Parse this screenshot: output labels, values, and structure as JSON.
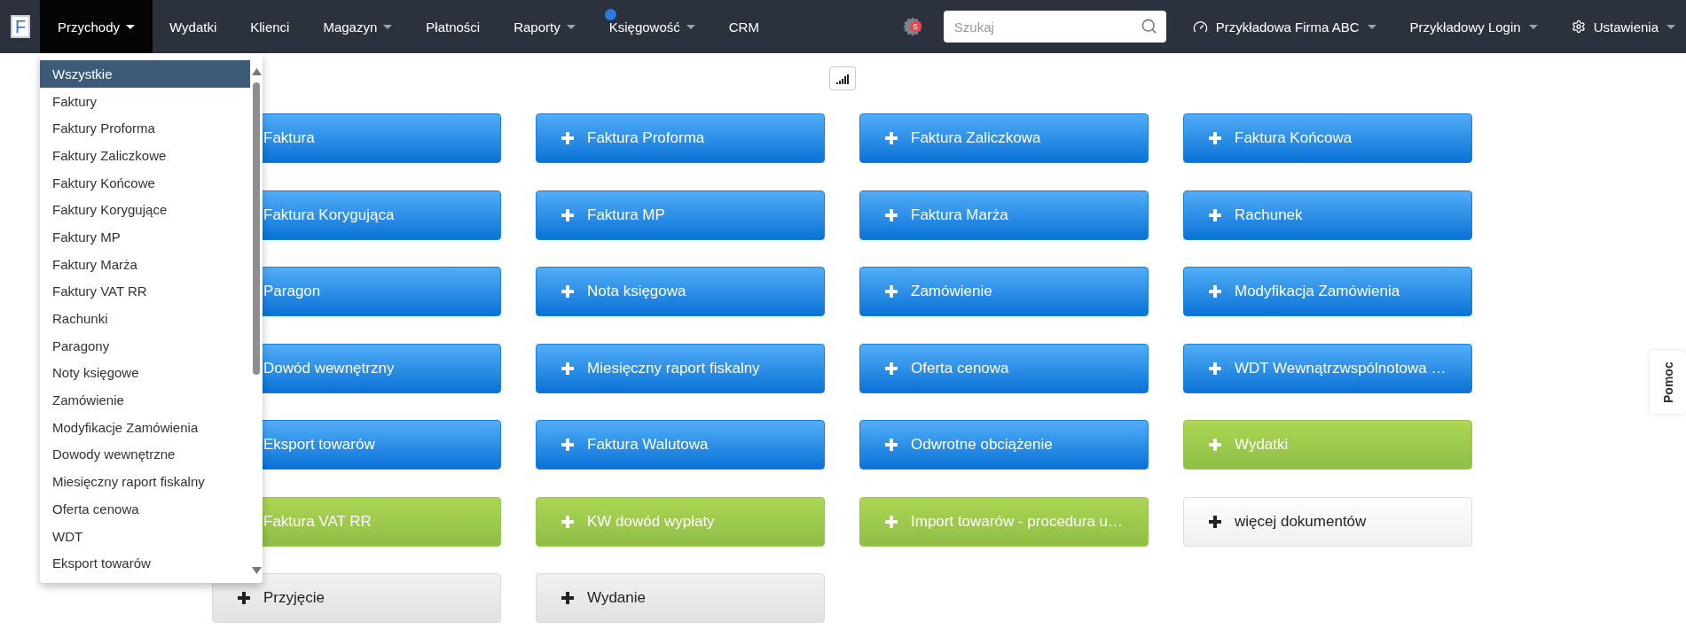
{
  "navbar": {
    "logo": "F",
    "items": [
      {
        "label": "Przychody",
        "selected": true,
        "dropdown": true,
        "info": false
      },
      {
        "label": "Wydatki",
        "selected": false,
        "dropdown": false,
        "info": false
      },
      {
        "label": "Klienci",
        "selected": false,
        "dropdown": false,
        "info": false
      },
      {
        "label": "Magazyn",
        "selected": false,
        "dropdown": true,
        "info": false
      },
      {
        "label": "Płatności",
        "selected": false,
        "dropdown": false,
        "info": false
      },
      {
        "label": "Raporty",
        "selected": false,
        "dropdown": true,
        "info": false
      },
      {
        "label": "Księgowość",
        "selected": false,
        "dropdown": true,
        "info": true
      },
      {
        "label": "CRM",
        "selected": false,
        "dropdown": false,
        "info": false
      }
    ],
    "notification_count": "5",
    "search": {
      "placeholder": "Szukaj"
    },
    "right_menus": [
      {
        "label": "Przykładowa Firma ABC",
        "kind": "dashboard"
      },
      {
        "label": "Przykładowy Login",
        "kind": "plain"
      },
      {
        "label": "Ustawienia",
        "kind": "settings"
      }
    ]
  },
  "dropdown_menu": {
    "items": [
      {
        "label": "Wszystkie",
        "selected": true
      },
      {
        "label": "Faktury",
        "selected": false
      },
      {
        "label": "Faktury Proforma",
        "selected": false
      },
      {
        "label": "Faktury Zaliczkowe",
        "selected": false
      },
      {
        "label": "Faktury Końcowe",
        "selected": false
      },
      {
        "label": "Faktury Korygujące",
        "selected": false
      },
      {
        "label": "Faktury MP",
        "selected": false
      },
      {
        "label": "Faktury Marża",
        "selected": false
      },
      {
        "label": "Faktury VAT RR",
        "selected": false
      },
      {
        "label": "Rachunki",
        "selected": false
      },
      {
        "label": "Paragony",
        "selected": false
      },
      {
        "label": "Noty księgowe",
        "selected": false
      },
      {
        "label": "Zamówienie",
        "selected": false
      },
      {
        "label": "Modyfikacje Zamówienia",
        "selected": false
      },
      {
        "label": "Dowody wewnętrzne",
        "selected": false
      },
      {
        "label": "Miesięczny raport fiskalny",
        "selected": false
      },
      {
        "label": "Oferta cenowa",
        "selected": false
      },
      {
        "label": "WDT",
        "selected": false
      },
      {
        "label": "Eksport towarów",
        "selected": false
      }
    ]
  },
  "document_buttons": [
    {
      "label": "Faktura",
      "kind": "primary",
      "plus": false
    },
    {
      "label": "Faktura Proforma",
      "kind": "primary",
      "plus": true
    },
    {
      "label": "Faktura Zaliczkowa",
      "kind": "primary",
      "plus": true
    },
    {
      "label": "Faktura Końcowa",
      "kind": "primary",
      "plus": true
    },
    {
      "label": "Faktura Korygująca",
      "kind": "primary",
      "plus": false
    },
    {
      "label": "Faktura MP",
      "kind": "primary",
      "plus": true
    },
    {
      "label": "Faktura Marża",
      "kind": "primary",
      "plus": true
    },
    {
      "label": "Rachunek",
      "kind": "primary",
      "plus": true
    },
    {
      "label": "Paragon",
      "kind": "primary",
      "plus": false
    },
    {
      "label": "Nota księgowa",
      "kind": "primary",
      "plus": true
    },
    {
      "label": "Zamówienie",
      "kind": "primary",
      "plus": true
    },
    {
      "label": "Modyfikacja Zamówienia",
      "kind": "primary",
      "plus": true
    },
    {
      "label": "Dowód wewnętrzny",
      "kind": "primary",
      "plus": false
    },
    {
      "label": "Miesięczny raport fiskalny",
      "kind": "primary",
      "plus": true
    },
    {
      "label": "Oferta cenowa",
      "kind": "primary",
      "plus": true
    },
    {
      "label": "WDT Wewnątrzwspólnotowa …",
      "kind": "primary",
      "plus": true
    },
    {
      "label": "Eksport towarów",
      "kind": "primary",
      "plus": false
    },
    {
      "label": "Faktura Walutowa",
      "kind": "primary",
      "plus": true
    },
    {
      "label": "Odwrotne obciążenie",
      "kind": "primary",
      "plus": true
    },
    {
      "label": "Wydatki",
      "kind": "success",
      "plus": true
    },
    {
      "label": "Faktura VAT RR",
      "kind": "success",
      "plus": false
    },
    {
      "label": "KW dowód wypłaty",
      "kind": "success",
      "plus": true
    },
    {
      "label": "Import towarów - procedura u…",
      "kind": "success",
      "plus": true
    },
    {
      "label": "więcej dokumentów",
      "kind": "light",
      "plus": true
    },
    {
      "label": "Przyjęcie",
      "kind": "default",
      "plus": true
    },
    {
      "label": "Wydanie",
      "kind": "default",
      "plus": true
    }
  ],
  "help_tab": "Pomoc"
}
